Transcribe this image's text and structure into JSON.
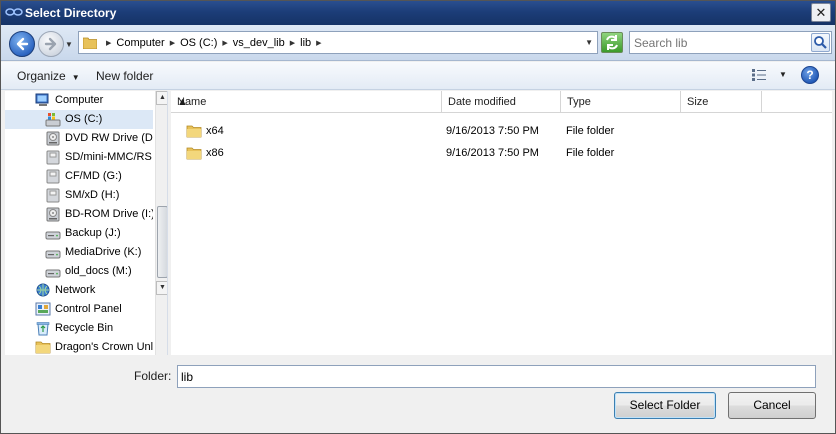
{
  "window": {
    "title": "Select Directory",
    "close_glyph": "✕"
  },
  "address": {
    "crumbs": [
      "Computer",
      "OS (C:)",
      "vs_dev_lib",
      "lib"
    ]
  },
  "search": {
    "placeholder": "Search lib"
  },
  "toolbar": {
    "organize": "Organize",
    "new_folder": "New folder",
    "help": "?"
  },
  "nav": {
    "items": [
      {
        "label": "Computer",
        "icon": "computer-icon",
        "indent": 1
      },
      {
        "label": "OS (C:)",
        "icon": "windows-drive-icon",
        "indent": 2,
        "selected": true
      },
      {
        "label": "DVD RW Drive (D:",
        "icon": "optical-drive-icon",
        "indent": 2
      },
      {
        "label": "SD/mini-MMC/RS (",
        "icon": "card-drive-icon",
        "indent": 2
      },
      {
        "label": "CF/MD (G:)",
        "icon": "card-drive-icon",
        "indent": 2
      },
      {
        "label": "SM/xD (H:)",
        "icon": "card-drive-icon",
        "indent": 2
      },
      {
        "label": "BD-ROM Drive (I:)",
        "icon": "optical-drive-icon",
        "indent": 2
      },
      {
        "label": "Backup (J:)",
        "icon": "hard-drive-icon",
        "indent": 2
      },
      {
        "label": "MediaDrive (K:)",
        "icon": "hard-drive-icon",
        "indent": 2
      },
      {
        "label": "old_docs (M:)",
        "icon": "hard-drive-icon",
        "indent": 2
      },
      {
        "label": "Network",
        "icon": "network-icon",
        "indent": 1
      },
      {
        "label": "Control Panel",
        "icon": "control-panel-icon",
        "indent": 1
      },
      {
        "label": "Recycle Bin",
        "icon": "recycle-bin-icon",
        "indent": 1
      },
      {
        "label": "Dragon's Crown Unlo",
        "icon": "folder-icon",
        "indent": 1
      }
    ]
  },
  "files": {
    "columns": [
      "Name",
      "Date modified",
      "Type",
      "Size"
    ],
    "rows": [
      {
        "name": "x64",
        "date": "9/16/2013 7:50 PM",
        "type": "File folder",
        "size": ""
      },
      {
        "name": "x86",
        "date": "9/16/2013 7:50 PM",
        "type": "File folder",
        "size": ""
      }
    ]
  },
  "footer": {
    "folder_label": "Folder:",
    "folder_value": "lib",
    "select_button": "Select Folder",
    "cancel_button": "Cancel"
  },
  "colors": {
    "title_bar": "#1c3d78",
    "selection": "#dce8f6",
    "folder": "#e8c25a"
  }
}
